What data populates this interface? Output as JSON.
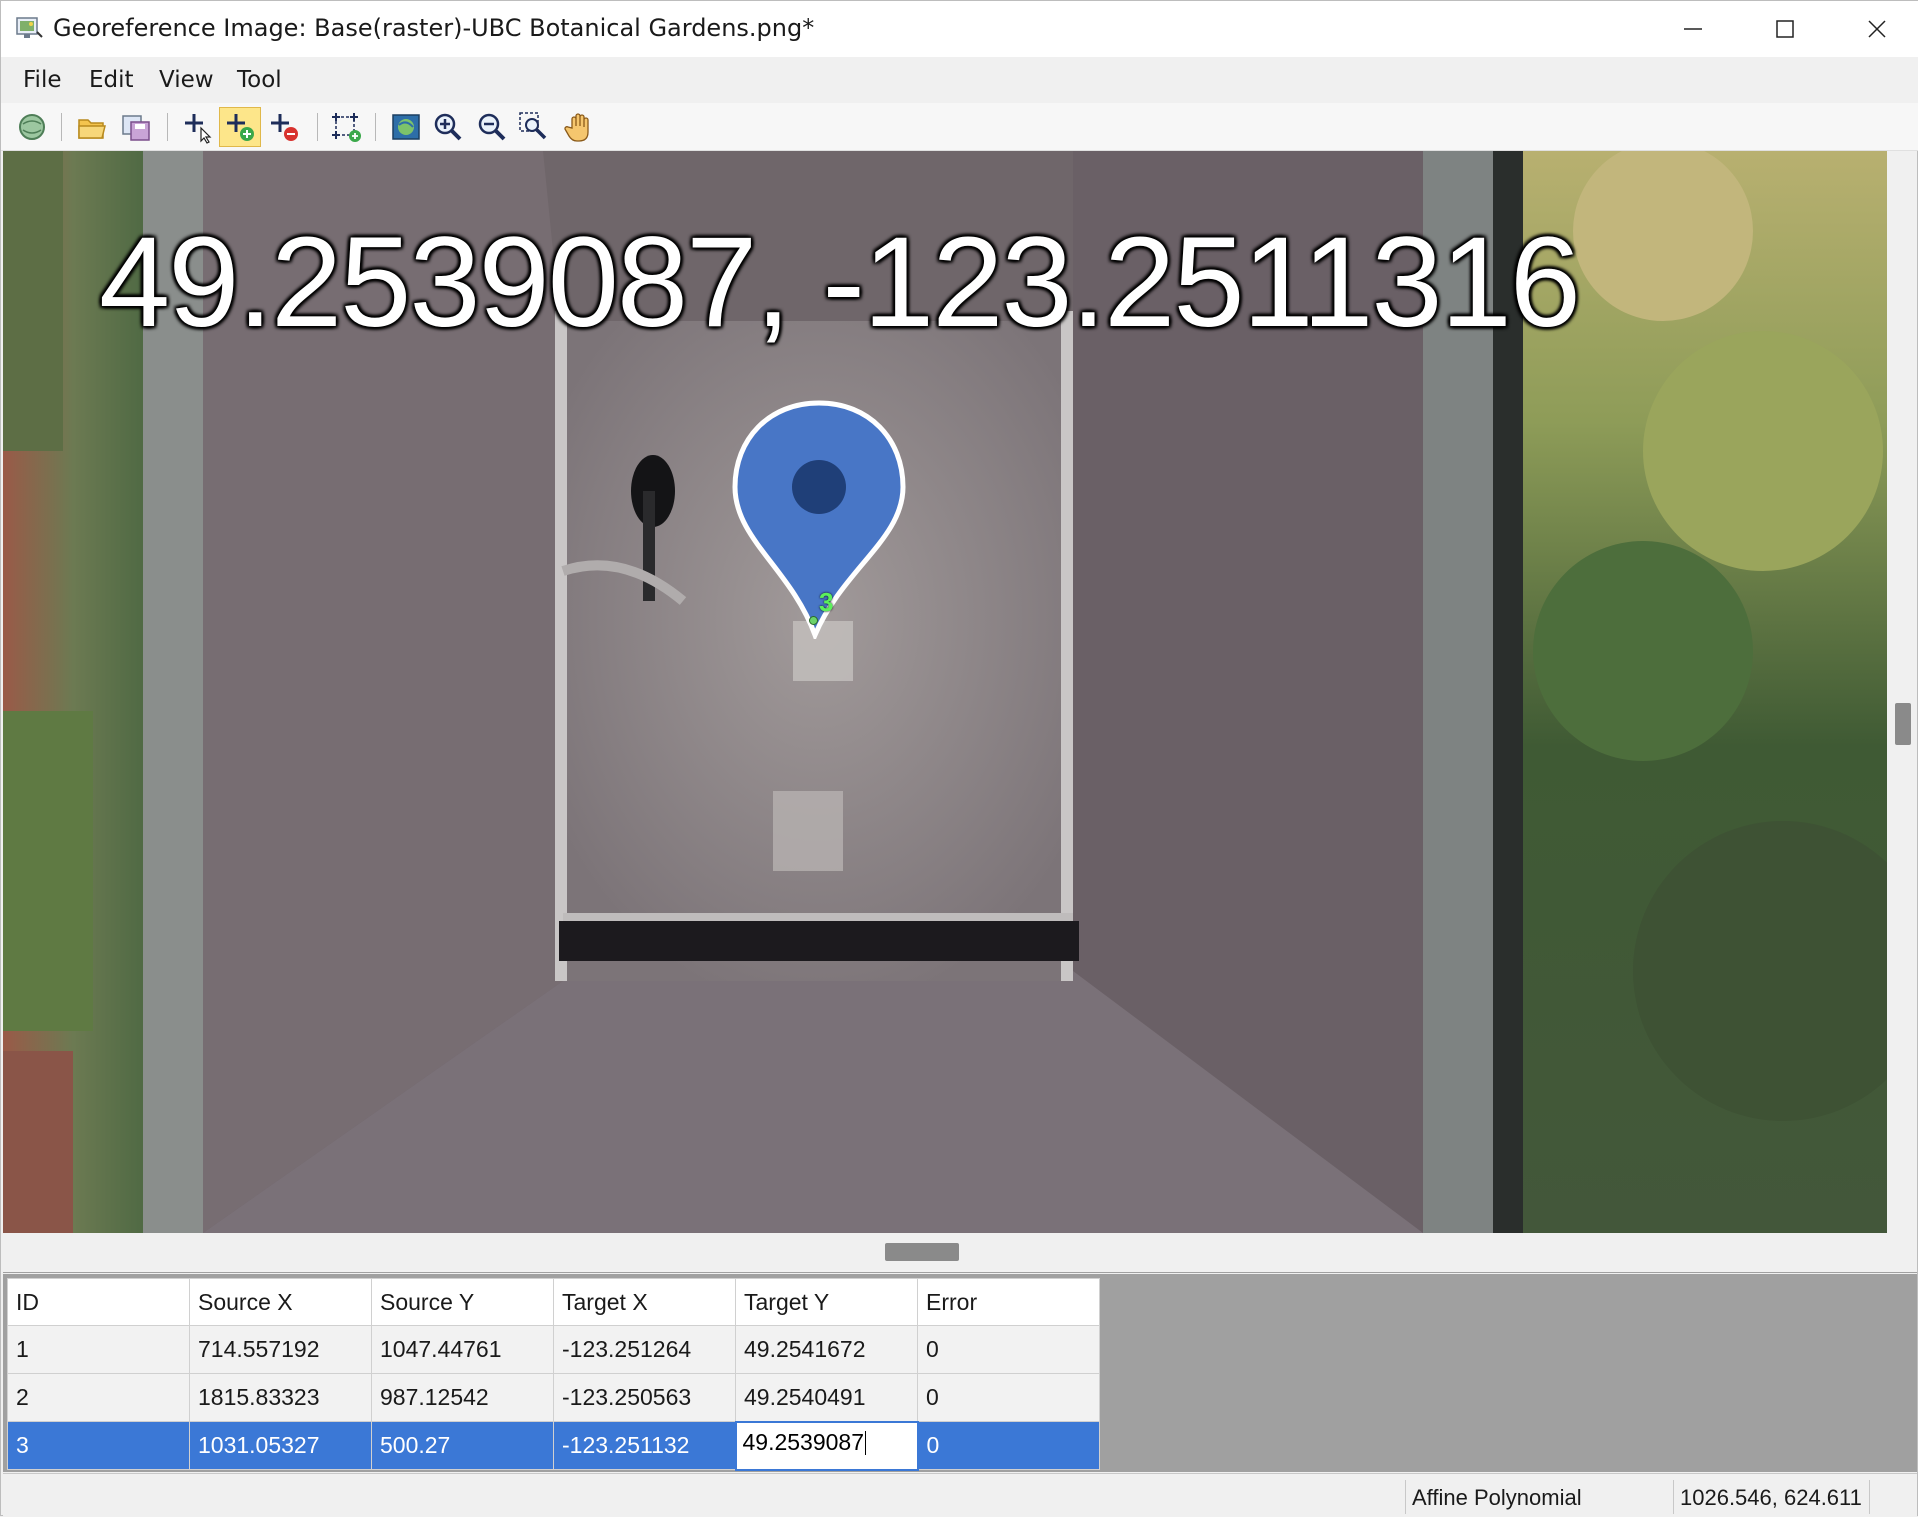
{
  "window": {
    "title": "Georeference Image: Base(raster)-UBC Botanical Gardens.png*"
  },
  "menubar": {
    "items": [
      "File",
      "Edit",
      "View",
      "Tool"
    ]
  },
  "toolbar": {
    "buttons": [
      {
        "icon": "georeference-icon"
      },
      {
        "icon": "open-folder-icon"
      },
      {
        "icon": "save-image-icon"
      },
      {
        "icon": "select-point-icon"
      },
      {
        "icon": "add-point-icon",
        "active": true
      },
      {
        "icon": "delete-point-icon"
      },
      {
        "icon": "fit-points-icon"
      },
      {
        "icon": "full-extent-icon"
      },
      {
        "icon": "zoom-in-icon"
      },
      {
        "icon": "zoom-out-icon"
      },
      {
        "icon": "zoom-box-icon"
      },
      {
        "icon": "pan-hand-icon"
      }
    ]
  },
  "map": {
    "overlay_text": "49.2539087, -123.2511316",
    "point_label": "3"
  },
  "table": {
    "columns": [
      "ID",
      "Source X",
      "Source Y",
      "Target X",
      "Target Y",
      "Error"
    ],
    "rows": [
      [
        "1",
        "714.557192",
        "1047.44761",
        "-123.251264",
        "49.2541672",
        "0"
      ],
      [
        "2",
        "1815.83323",
        "987.12542",
        "-123.250563",
        "49.2540491",
        "0"
      ],
      [
        "3",
        "1031.05327",
        "500.27",
        "-123.251132",
        "49.2539087",
        "0"
      ]
    ],
    "selected_row": 3,
    "editing_cell": "Target Y"
  },
  "statusbar": {
    "transform": "Affine Polynomial",
    "cursor_coords": "1026.546, 624.611"
  },
  "colors": {
    "selection": "#3b78d6",
    "pin": "#4878c8",
    "point_label": "#5cf05c",
    "active_tool": "#fde68a"
  }
}
